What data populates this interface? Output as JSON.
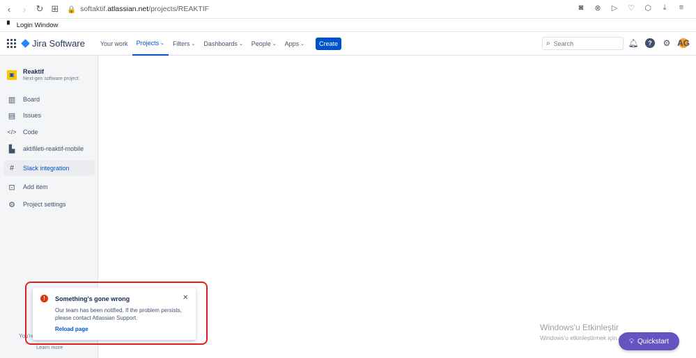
{
  "browser": {
    "url_prefix": "softaktif.",
    "url_host": "atlassian.net",
    "url_path": "/projects/REAKTIF",
    "bookmark": "Login Window"
  },
  "topnav": {
    "product": "Jira Software",
    "items": [
      {
        "label": "Your work",
        "caret": ""
      },
      {
        "label": "Projects",
        "caret": "⌄"
      },
      {
        "label": "Filters",
        "caret": "⌄"
      },
      {
        "label": "Dashboards",
        "caret": "⌄"
      },
      {
        "label": "People",
        "caret": "⌄"
      },
      {
        "label": "Apps",
        "caret": "⌄"
      }
    ],
    "create_label": "Create",
    "search_placeholder": "Search",
    "avatar_initials": "AG"
  },
  "sidebar": {
    "project_name": "Reaktif",
    "project_type": "Next-gen software project",
    "items": [
      {
        "label": "Board",
        "icon": "board-icon"
      },
      {
        "label": "Issues",
        "icon": "issues-icon"
      },
      {
        "label": "Code",
        "icon": "code-icon"
      },
      {
        "label": "aktifileti-reaktif-mobile",
        "icon": "repo-icon"
      },
      {
        "label": "Slack integration",
        "icon": "slack-icon"
      },
      {
        "label": "Add item",
        "icon": "add-item-icon"
      },
      {
        "label": "Project settings",
        "icon": "gear-icon"
      }
    ],
    "footer_partial": "You're",
    "footer_link": "Learn more"
  },
  "flag": {
    "title": "Something's gone wrong",
    "message": "Our team has been notified. If the problem persists, please contact Atlassian Support.",
    "action": "Reload page"
  },
  "watermark": {
    "line1": "Windows'u Etkinleştir",
    "line2": "Windows'u etkinleştirmek için Ayarlar'a gidin."
  },
  "quickstart_label": "Quickstart",
  "colors": {
    "brand": "#0052cc",
    "error": "#de350b",
    "highlight": "#e01e1e",
    "quickstart": "#6554c0"
  }
}
